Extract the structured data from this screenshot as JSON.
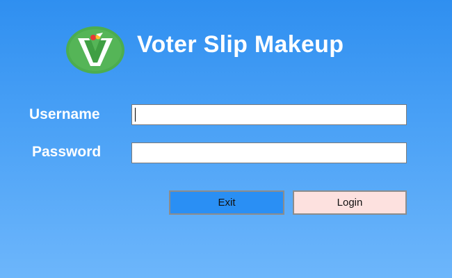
{
  "app": {
    "title": "Voter Slip Makeup",
    "logo_icon": "voter-v-checkmark-logo",
    "colors": {
      "background_top": "#2f8ff0",
      "background_bottom": "#6db6fb",
      "logo_green": "#4caf50",
      "exit_button": "#2a8ff4",
      "login_button": "#fde1df"
    }
  },
  "form": {
    "username_label": "Username",
    "username_value": "",
    "password_label": "Password",
    "password_value": ""
  },
  "buttons": {
    "exit_label": "Exit",
    "login_label": "Login"
  }
}
